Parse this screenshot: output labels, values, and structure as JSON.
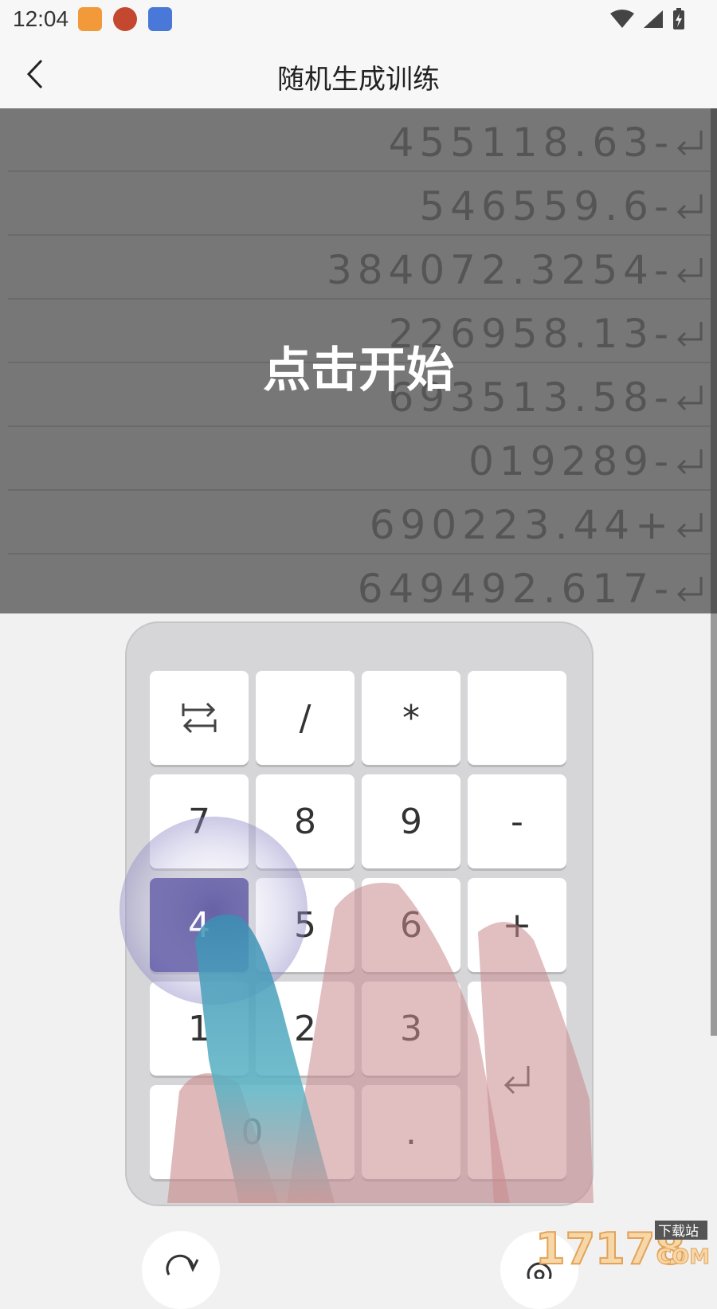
{
  "status_bar": {
    "time": "12:04"
  },
  "header": {
    "title": "随机生成训练"
  },
  "records": [
    {
      "value": "455118.63-"
    },
    {
      "value": "546559.6-"
    },
    {
      "value": "384072.3254-"
    },
    {
      "value": "226958.13-"
    },
    {
      "value": "693513.58-"
    },
    {
      "value": "019289-"
    },
    {
      "value": "690223.44+"
    },
    {
      "value": "649492.617-"
    }
  ],
  "overlay": {
    "start_label": "点击开始"
  },
  "keypad": {
    "rows": [
      [
        "⇄",
        "/",
        "*",
        ""
      ],
      [
        "7",
        "8",
        "9",
        "-"
      ],
      [
        "4",
        "5",
        "6",
        "+"
      ],
      [
        "1",
        "2",
        "3",
        "↵"
      ],
      [
        "0",
        ".",
        "",
        ""
      ]
    ],
    "active_key": "4"
  },
  "watermark": {
    "brand": "17178",
    "sub": "下载站",
    "domain": "COM"
  }
}
